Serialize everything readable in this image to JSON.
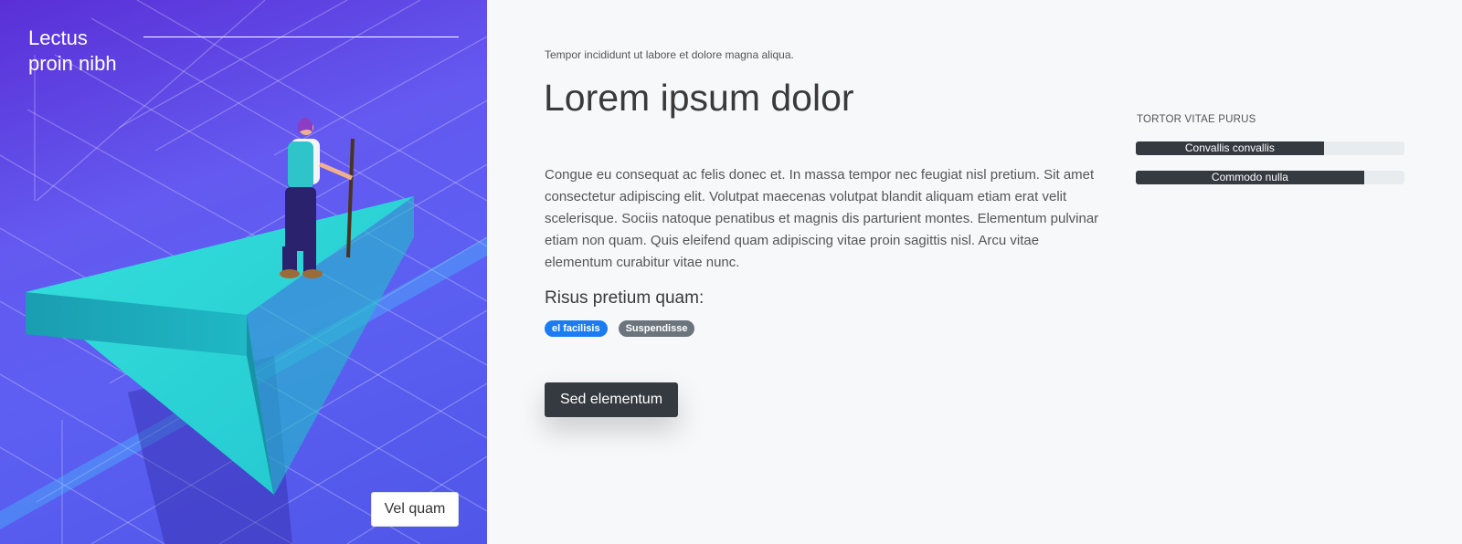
{
  "hero": {
    "title": "Lectus proin nibh",
    "button_label": "Vel quam",
    "colors": {
      "gradient_start": "#5a2fd6",
      "gradient_end": "#4f56e8",
      "arrow": "#2bd3d6"
    }
  },
  "main": {
    "eyebrow": "Tempor incididunt ut labore et dolore magna aliqua.",
    "title": "Lorem ipsum dolor",
    "body": "Congue eu consequat ac felis donec et. In massa tempor nec feugiat nisl pretium. Sit amet consectetur adipiscing elit. Volutpat maecenas volutpat blandit aliquam etiam erat velit scelerisque. Sociis natoque penatibus et magnis dis parturient montes. Elementum pulvinar etiam non quam. Quis eleifend quam adipiscing vitae proin sagittis nisl. Arcu vitae elementum curabitur vitae nunc.",
    "subheading": "Risus pretium quam:",
    "tags": [
      {
        "label": "el facilisis",
        "color": "#1a7cf0"
      },
      {
        "label": "Suspendisse",
        "color": "#6c757d"
      }
    ],
    "cta_label": "Sed elementum"
  },
  "progress": {
    "heading": "TORTOR VITAE PURUS",
    "bars": [
      {
        "label": "Convallis convallis",
        "percent": 70
      },
      {
        "label": "Commodo nulla",
        "percent": 85
      }
    ]
  }
}
